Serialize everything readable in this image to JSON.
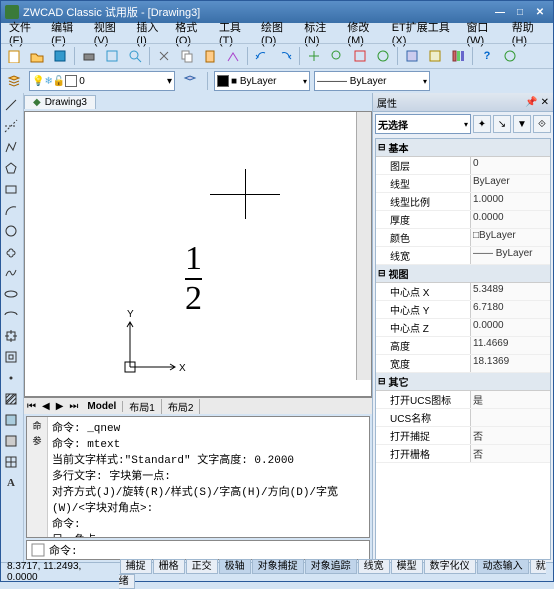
{
  "title": "ZWCAD Classic 试用版 - [Drawing3]",
  "menu": [
    "文件(F)",
    "编辑(E)",
    "视图(V)",
    "插入(I)",
    "格式(O)",
    "工具(T)",
    "绘图(D)",
    "标注(N)",
    "修改(M)",
    "ET扩展工具(X)",
    "窗口(W)",
    "帮助(H)"
  ],
  "doc_tab": "Drawing3",
  "layer_name": "0",
  "bylayer1": "■ ByLayer",
  "bylayer2": "——— ByLayer",
  "fraction": {
    "num": "1",
    "den": "2"
  },
  "axis_x": "X",
  "axis_y": "Y",
  "model_tabs": [
    "Model",
    "布局1",
    "布局2"
  ],
  "cmd_lines": "命令: _qnew\n命令: mtext\n当前文字样式:\"Standard\" 文字高度: 0.2000\n多行文字: 字块第一点:\n对齐方式(J)/旋转(R)/样式(S)/字高(H)/方向(D)/字宽(W)/<字块对角点>:\n命令:\n另一角点:",
  "cmd_prompt": "命令:",
  "props": {
    "title": "属性",
    "noselect": "无选择",
    "cats": [
      {
        "name": "基本",
        "rows": [
          {
            "k": "图层",
            "v": "0"
          },
          {
            "k": "线型",
            "v": "ByLayer"
          },
          {
            "k": "线型比例",
            "v": "1.0000"
          },
          {
            "k": "厚度",
            "v": "0.0000"
          },
          {
            "k": "颜色",
            "v": "□ByLayer"
          },
          {
            "k": "线宽",
            "v": "—— ByLayer"
          }
        ]
      },
      {
        "name": "视图",
        "rows": [
          {
            "k": "中心点 X",
            "v": "5.3489"
          },
          {
            "k": "中心点 Y",
            "v": "6.7180"
          },
          {
            "k": "中心点 Z",
            "v": "0.0000"
          },
          {
            "k": "高度",
            "v": "11.4669"
          },
          {
            "k": "宽度",
            "v": "18.1369"
          }
        ]
      },
      {
        "name": "其它",
        "rows": [
          {
            "k": "打开UCS图标",
            "v": "是"
          },
          {
            "k": "UCS名称",
            "v": ""
          },
          {
            "k": "打开捕捉",
            "v": "否"
          },
          {
            "k": "打开栅格",
            "v": "否"
          }
        ]
      }
    ]
  },
  "status": {
    "coords": "8.3717, 11.2493, 0.0000",
    "btns": [
      "捕捉",
      "栅格",
      "正交",
      "极轴",
      "对象捕捉",
      "对象追踪",
      "线宽",
      "模型",
      "数字化仪",
      "动态输入",
      "就绪"
    ]
  }
}
